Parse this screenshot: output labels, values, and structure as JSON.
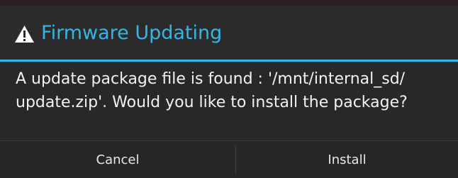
{
  "dialog": {
    "title": "Firmware Updating",
    "title_icon": "warning-triangle-icon",
    "message": "A update package file is found : '/mnt/internal_sd/ update.zip'. Would you like to install the package?",
    "buttons": {
      "cancel_label": "Cancel",
      "install_label": "Install"
    }
  },
  "colors": {
    "accent": "#33b5e5",
    "background": "#282828",
    "text": "#f2f2f2"
  }
}
